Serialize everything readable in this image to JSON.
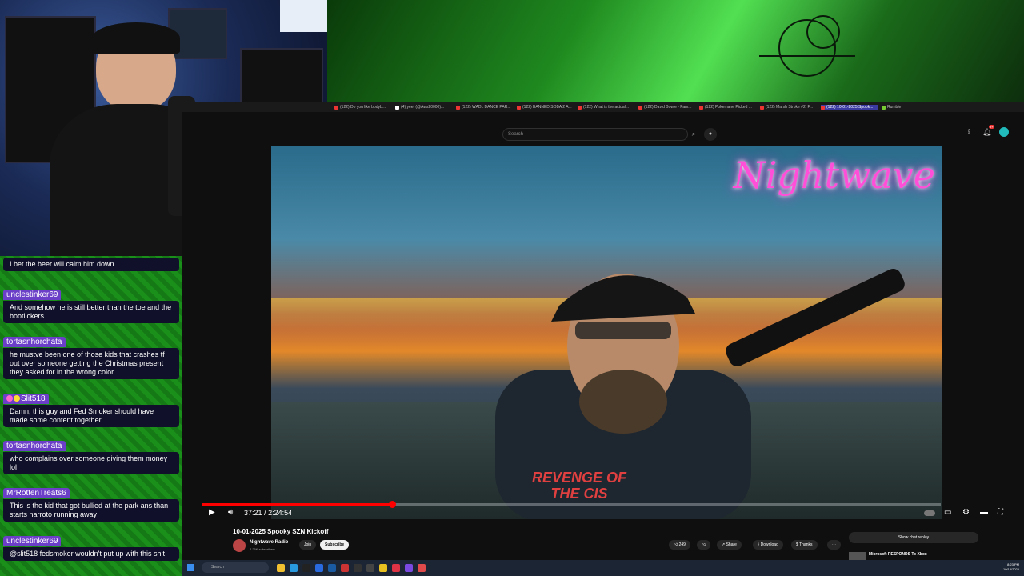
{
  "browser": {
    "tabs": [
      "(122) Do you like bodyb...",
      "(4) yeet (@Aws20000)...",
      "(122) WADL DANCE PAR...",
      "(122) BANNED SOBA 2 A...",
      "(122) What is the actual...",
      "(122) David Bowie - Fam...",
      "(122) Pokemane Picked ...",
      "(122) Marsh Stroke #2: F...",
      "(122) 10-01-2025 Spook...",
      "Rumble"
    ]
  },
  "youtube": {
    "search_placeholder": "Search",
    "notifications_badge": "9+",
    "video_logo_text": "Nightwave",
    "shirt_text": "REVENGE OF THE CIS",
    "time_current": "37:21",
    "time_sep": "/",
    "time_total": "2:24:54",
    "progress_fraction": 0.258,
    "video_title": "10-01-2025 Spooky SZN Kickoff",
    "channel_name": "Nightwave Radio",
    "channel_subs": "2.25K subscribers",
    "join_label": "Join",
    "subscribe_label": "Subscribe",
    "likes": "249",
    "share_label": "Share",
    "download_label": "Download",
    "thanks_label": "Thanks",
    "more_label": "⋯",
    "chat_replay_label": "Show chat replay",
    "recommended_title": "Microsoft RESPONDS To Xbox"
  },
  "taskbar": {
    "search_placeholder": "Search",
    "time": "8:23 PM",
    "date": "10/13/2025"
  },
  "chat": [
    {
      "user": "",
      "text": "I bet the beer will calm him down"
    },
    {
      "user": "unclestinker69",
      "text": "And somehow he is still better than the toe and the bootlickers"
    },
    {
      "user": "tortasnhorchata",
      "text": "he mustve been one of those kids that crashes tf out over someone getting the Christmas present they asked for in the wrong color"
    },
    {
      "user": "Slit518",
      "text": "Damn, this guy and Fed Smoker should have made some content together."
    },
    {
      "user": "tortasnhorchata",
      "text": "who complains over someone giving them money lol"
    },
    {
      "user": "MrRottenTreats6",
      "text": "This is the kid that got bullied at the park ans than starts narroto running away"
    },
    {
      "user": "unclestinker69",
      "text": "@slit518 fedsmoker wouldn't put up with this shit"
    }
  ],
  "colors": {
    "progress": "#ff0000",
    "username_bg": "#6b3fc7",
    "message_bg": "#10102a",
    "frame_green": "#1a8f1a",
    "logo_pink": "#ff4fd8"
  }
}
